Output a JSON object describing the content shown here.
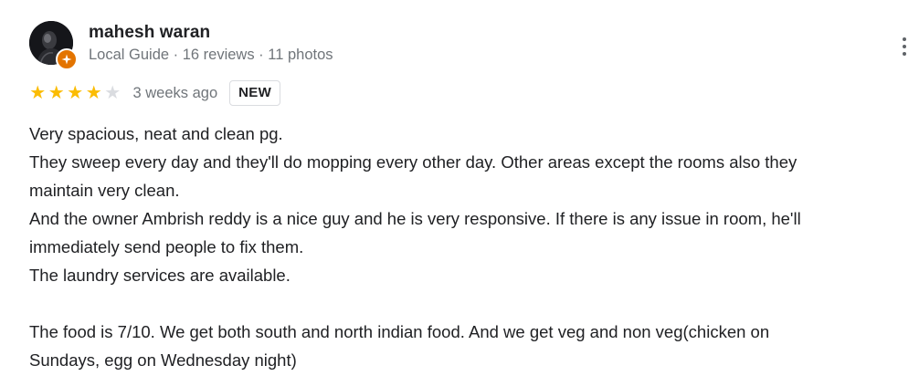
{
  "reviewer": {
    "name": "mahesh waran",
    "meta": "Local Guide · 16 reviews · 11 photos"
  },
  "rating": {
    "stars": 4,
    "max": 5,
    "date": "3 weeks ago",
    "badge": "NEW"
  },
  "review": {
    "paragraphs": [
      [
        "Very spacious, neat and clean pg."
      ],
      [
        "They sweep every day and they'll do mopping every other day. Other areas except the rooms also they",
        "maintain very clean."
      ],
      [
        "And the owner Ambrish reddy is a nice guy and he is very responsive. If there is any issue in room, he'll",
        "immediately send people to fix them."
      ],
      [
        "The laundry services are available."
      ],
      [
        ""
      ],
      [
        "The food is 7/10. We get both south and north indian food. And we get veg and non veg(chicken on",
        "Sundays, egg on Wednesday night)"
      ]
    ]
  },
  "colors": {
    "star": "#fbbc04",
    "star_empty": "#dadce0",
    "badge_orange": "#e37400",
    "muted_text": "#70757a"
  },
  "icons": {
    "avatar": "profile-photo",
    "badge": "local-guide-star-icon",
    "menu": "more-vert-icon",
    "star": "star-icon"
  }
}
